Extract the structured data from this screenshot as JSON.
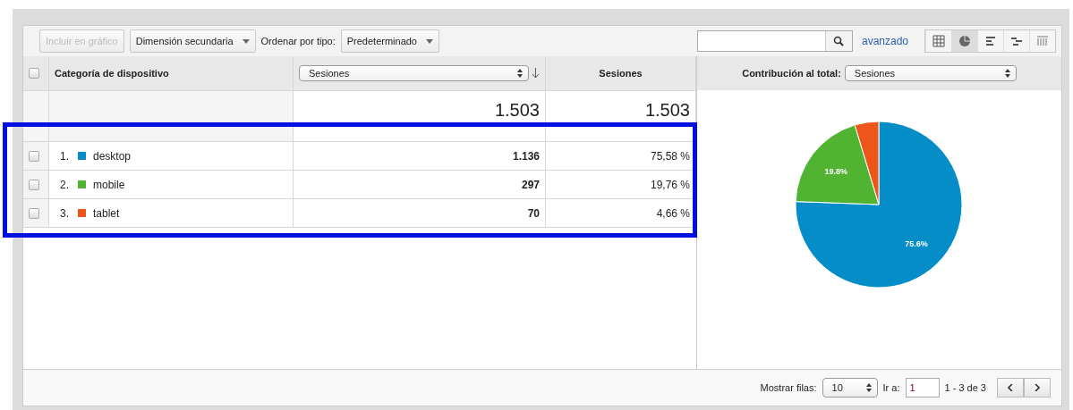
{
  "toolbar": {
    "include_button": {
      "label": "Incluir en gráfico",
      "disabled": true
    },
    "secondary_dimension": "Dimensión secundaria",
    "sort_label": "Ordenar por tipo:",
    "sort_value": "Predeterminado",
    "advanced_link": "avanzado",
    "view_buttons": [
      {
        "kind": "table",
        "selected": false
      },
      {
        "kind": "pie",
        "selected": true
      },
      {
        "kind": "bars",
        "selected": false
      },
      {
        "kind": "compare",
        "selected": false
      },
      {
        "kind": "pivot",
        "selected": false
      }
    ]
  },
  "table": {
    "all_checked": false,
    "columns": [
      {
        "kind": "dimension",
        "label": "Categoría de dispositivo"
      },
      {
        "kind": "select",
        "label": "Sesiones"
      },
      {
        "kind": "metric",
        "label": "Sesiones"
      }
    ],
    "totals": [
      "1.503",
      "1.503"
    ],
    "rows": [
      {
        "index": "1.",
        "name": "desktop",
        "color": "#058dc7",
        "value": "1.136",
        "share": "75,58 %",
        "checked": false
      },
      {
        "index": "2.",
        "name": "mobile",
        "color": "#50b432",
        "value": "297",
        "share": "19,76 %",
        "checked": false
      },
      {
        "index": "3.",
        "name": "tablet",
        "color": "#ed561b",
        "value": "70",
        "share": "4,66 %",
        "checked": false
      }
    ]
  },
  "contribution": {
    "label": "Contribución al total:",
    "value": "Sesiones",
    "chart_data": {
      "type": "pie",
      "values": [
        75.58,
        19.76,
        4.66
      ],
      "value_labels": [
        "75.6%",
        "19.8%",
        null
      ]
    }
  },
  "footer": {
    "rows_label": "Mostrar filas:",
    "rows_value": "10",
    "goto_label": "Ir a:",
    "goto_value": "1",
    "range": "1 - 3 de 3"
  },
  "highlight": {
    "shown": true
  }
}
